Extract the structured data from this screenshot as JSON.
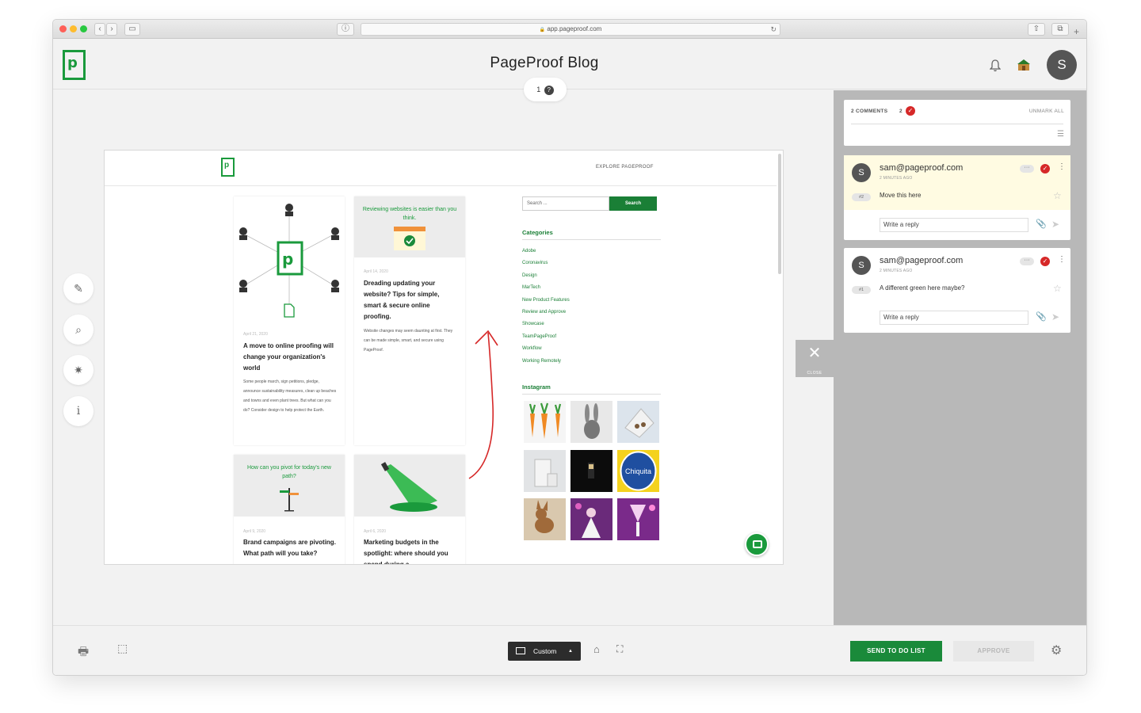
{
  "browser": {
    "url": "app.pageproof.com",
    "lock": "🔒",
    "buttons": {
      "back": "‹",
      "forward": "›",
      "sidebar": "▭",
      "share": "⇧",
      "tabs": "⧉",
      "newtab": "+",
      "reload": "↻",
      "shield": "ⓘ"
    }
  },
  "app": {
    "title": "PageProof Blog",
    "logo_letter": "p",
    "user_initial": "S",
    "version": "1",
    "version_help": "?"
  },
  "tools": [
    {
      "name": "pen-tool",
      "icon": "✎"
    },
    {
      "name": "zoom-tool",
      "icon": "⌕"
    },
    {
      "name": "magic-tool",
      "icon": "✷"
    },
    {
      "name": "info-tool",
      "icon": "i"
    }
  ],
  "proof": {
    "explore_label": "EXPLORE PAGEPROOF",
    "logo_letter": "p",
    "cards": [
      {
        "date": "April 21, 2020",
        "title": "A move to online proofing will change your organization's world",
        "excerpt": "Some people march, sign petitions, pledge, announce sustainability measures, clean up beaches and towns and even plant trees. But what can you do? Consider design to help protect the Earth."
      },
      {
        "banner": "Reviewing websites is easier than you think.",
        "date": "April 14, 2020",
        "title": "Dreading updating your website? Tips for simple, smart & secure online proofing.",
        "excerpt": "Website changes may seem daunting at first. They can be made simple, smart, and secure using PageProof."
      },
      {
        "banner": "How can you pivot for today's new path?",
        "date": "April 9, 2020",
        "title": "Brand campaigns are pivoting. What path will you take?"
      },
      {
        "date": "April 6, 2020",
        "title": "Marketing budgets in the spotlight: where should you spend during a"
      }
    ],
    "search_placeholder": "Search ...",
    "search_button": "Search",
    "categories_heading": "Categories",
    "categories": [
      "Adobe",
      "Coronavirus",
      "Design",
      "MarTech",
      "New Product Features",
      "Review and Approve",
      "Showcase",
      "TeamPageProof",
      "Workflow",
      "Working Remotely"
    ],
    "instagram_heading": "Instagram",
    "chiquita_label": "Chiquita"
  },
  "close_tab": {
    "icon": "✕",
    "label": "CLOSE"
  },
  "comments_panel": {
    "count_label": "2 COMMENTS",
    "done_count": "2",
    "unmark_all": "UNMARK ALL",
    "filter_icon": "☰",
    "check": "✓",
    "comments": [
      {
        "avatar": "S",
        "author": "sam@pageproof.com",
        "time": "2 MINUTES AGO",
        "pin": "#2",
        "text": "Move this here",
        "reply_placeholder": "Write a reply",
        "menu": "⋮",
        "more": "···",
        "star": "☆",
        "clip": "📎",
        "send": "➤"
      },
      {
        "avatar": "S",
        "author": "sam@pageproof.com",
        "time": "2 MINUTES AGO",
        "pin": "#1",
        "text": "A different green here maybe?",
        "reply_placeholder": "Write a reply",
        "menu": "⋮",
        "more": "···",
        "star": "☆",
        "clip": "📎",
        "send": "➤"
      }
    ]
  },
  "bottom": {
    "print_icon": "🖶",
    "comment_icon": "⬚",
    "zoom_label": "Custom",
    "zoom_caret": "▲",
    "home_icon": "⌂",
    "expand_icon": "⛶",
    "send_todo": "SEND TO DO LIST",
    "approve": "APPROVE",
    "settings_icon": "⚙"
  },
  "colors": {
    "brand_green": "#1a9a3c",
    "red_check": "#d62828",
    "panel_gray": "#b8b8b8",
    "highlight": "#fffbe2"
  }
}
